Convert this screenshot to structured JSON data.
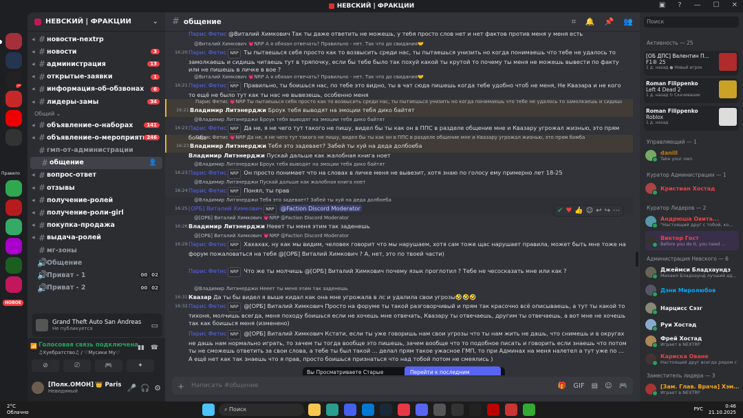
{
  "window": {
    "title": "НЕВСКИЙ | ФРАКЦИИ"
  },
  "guild": {
    "name": "НЕВСКИЙ | ФРАКЦИИ"
  },
  "channels": [
    {
      "name": "новости-nextrp",
      "badge": ""
    },
    {
      "name": "новости",
      "badge": "3"
    },
    {
      "name": "администрация",
      "badge": "13"
    },
    {
      "name": "открытые-заявки",
      "badge": "1"
    },
    {
      "name": "информация-об-обзвонах",
      "badge": "6"
    },
    {
      "name": "лидеры-замы",
      "badge": "34"
    }
  ],
  "category": "Общий",
  "channels2": [
    {
      "name": "объявление-о-наборах",
      "badge": "141"
    },
    {
      "name": "объявление-о-мероприятиях",
      "badge": "246"
    },
    {
      "name": "гмп-от-администрации",
      "badge": ""
    },
    {
      "name": "общение",
      "badge": ""
    },
    {
      "name": "вопрос-ответ",
      "badge": ""
    },
    {
      "name": "отзывы",
      "badge": ""
    },
    {
      "name": "получение-ролей",
      "badge": ""
    },
    {
      "name": "получение-роли-girl",
      "badge": ""
    },
    {
      "name": "покупка-продажа",
      "badge": ""
    },
    {
      "name": "выдача-ролей",
      "badge": ""
    },
    {
      "name": "мг-зоны",
      "badge": ""
    },
    {
      "name": "Общение",
      "badge": ""
    },
    {
      "name": "Приват - 1",
      "badge": ""
    },
    {
      "name": "Приват - 2",
      "badge": ""
    }
  ],
  "voice_counts": {
    "a": "00",
    "b": "02"
  },
  "game": {
    "name": "Grand Theft Auto San Andreas",
    "sub": "Не публикуется"
  },
  "voice": {
    "status": "Голосовая связь подключена",
    "sub": "♫Хуебратство♫ / ♡Мусики My♡"
  },
  "user": {
    "name": "[Полк.ОМОН] 👑 Paris Fet👑",
    "status": "Невидимый"
  },
  "new_label": "НОВОЕ",
  "servers_label": "Правило",
  "channel_header": {
    "name": "общение"
  },
  "messages": [
    {
      "time": "",
      "reply": "@Виталий Химкович  Так ты даже ответить не можешь, у тебя просто слов нет и нет фактов против меня у меня есть",
      "author": "Парис Фетис",
      "tag": "NRP",
      "text": ""
    },
    {
      "time": "16:20",
      "reply": "@Виталий Химкович 💗NRP  А я обязан отвечать? Правильно - нет. Так что до свидания🤝",
      "author": "Парис Фетис",
      "tag": "NRP",
      "text": "Ты пытаешься себя просто как то возвысить среди нас, ты пытаешься унизить но когда понимаешь что тебе не удалось то замолкаешь и сидишь читаешь тут в тряпочку, если бы тебе было так похуй какой ты крутой то почему ты меня не можешь вывести по факту или не пишешь в личке в вое ?"
    },
    {
      "time": "16:21",
      "reply": "@Виталий Химкович 💗NRP  А я обязан отвечать? Правильно - нет. Так что до свидания🤝",
      "author": "Парис Фетис",
      "tag": "NRP",
      "text": "Правильно, ты боишься нас, по тебе это видно, ты в чат сюда пишешь когда тебе удобно чтоб не меня, Не Квазара и не кого то ещё не было тут как ты нас не вывезешь, особенно меня"
    },
    {
      "time": "16:21",
      "reply": "Парис Фетис 💗NRP  Ты пытаешься себя просто как то возвысить среди нас, ты пытаешься унизить но когда понимаешь что тебе не удалось то замолкаешь и сидишь читае",
      "author": "Владимир Литэнерджи",
      "tag": "",
      "text": "Броук тебя выводят на эмоции тебя дико байтят"
    },
    {
      "time": "16:23",
      "reply": "@Владимир Литэнерджи Броук тебя выводят на эмоции тебя дико байтят",
      "author": "Парис Фетис",
      "tag": "NRP",
      "text": "Да не, я не чего тут такого не пишу, видел бы ты как он в ППС в разделе общение мне и Квазару угрожал жизнью, это прям бомба"
    },
    {
      "time": "16:23",
      "reply": "Парис Фетис 💗NRP  Да не, я не чего тут такого не пишу, видел бы ты как он в ППС в разделе общение мне и Квазару угрожал жизнью, это прям бомба",
      "author": "Владимир Литэнерджи",
      "tag": "",
      "text": "Тебя это задевает? Забей ты хуй на деда долбоеба"
    },
    {
      "time": "",
      "reply": "",
      "author": "Владимир Литэнерджи",
      "tag": "",
      "text": "Пускай дальше как жалобная книга ноет"
    },
    {
      "time": "16:23",
      "reply": "@Владимир Литэнерджи Броук тебя выводят на эмоции тебя дико байтят",
      "author": "Парис Фетис",
      "tag": "NRP",
      "text": "Он просто понимает что на словах в личке меня не вывезит, хотя знаю по голосу ему примерно лет 18-25"
    },
    {
      "time": "16:24",
      "reply": "@Владимир Литэнерджи Пускай дальше как жалобная книга ноет",
      "author": "Парис Фетис",
      "tag": "NRP",
      "text": "Понял, ты прав"
    },
    {
      "time": "16:25",
      "reply": "@Владимир Литэнерджи Тебя это задевает? Забей ты хуй на деда долбоеба",
      "author": "[ОРБ] Виталий Химкович",
      "tag": "NRP",
      "text": "@Faction Discord Moderator"
    },
    {
      "time": "16:26",
      "reply": "@[ОРБ] Виталий Химкович 💗NRP  @Faction Discord Moderator",
      "author": "Владимир Литэнерджи",
      "tag": "",
      "text": "Нееет ты меня этим так заденешь"
    },
    {
      "time": "16:29",
      "reply": "@[ОРБ] Виталий Химкович 💗NRP  @Faction Discord Moderator",
      "author": "Парис Фетис",
      "tag": "NRP",
      "text": "Хахахах, ну как мы видим, человек говорит что мы нарушаем, хотя сам тоже щас нарушает правила, может быть мне тоже на форум пожаловаться на тебя @[ОРБ] Виталий Химкович ? А, нет, это по твоей части)"
    },
    {
      "time": "",
      "reply": "",
      "author": "Парис Фетис",
      "tag": "NRP",
      "text": "Что же ты молчишь @[ОРБ] Виталий Химкович почему язык проглотил ? Тебе не чесосказать мне или как ?"
    },
    {
      "time": "16:31",
      "reply": "@Владимир Литэнерджи Нееет ты меня этим так заденешь",
      "author": "Квазар",
      "tag": "",
      "text": "Да ты бы видел я выше кидал как она мне угрожала в лс и удалила свои угрозы🤣🤣🤣"
    },
    {
      "time": "16:32",
      "reply": "",
      "author": "Парис Фетис",
      "tag": "NRP",
      "text": "@[ОРБ] Виталий Химкович Просто на форуме ты такой разговорчивый и прям так красочно всё описываешь, а тут ты какой то тихоня, молчишь всегда, меня походу боишься если не хочешь мне отвечать, Квазару ты отвечаешь, другим ты отвечаешь, а вот мне не хочешь так как боишься меня (изменено)"
    },
    {
      "time": "",
      "reply": "",
      "author": "Парис Фетис",
      "tag": "NRP",
      "text": "@[ОРБ] Виталий Химкович Кстати, если ты уже говоришь нам свои угрозы что ты нам жить не дашь, что снимешь и в округах не дашь нам нормально играть, то зачем ты тогда вообще это пишешь, зачем вообще что то подобное писать и говорить если знаешь что потом ты не сможешь ответить за свои слова, а тебе ты был такой ... делал прям такое ужасное ГМП, то при Админах на меня налетел а тут уже по ... А ещё нет как так знаешь что я прав, просто боишься признаться что над тобой потом не смеялись )"
    }
  ],
  "old_messages": {
    "text": "Вы Просматриваете Старые Сообщения",
    "button": "Перейти к последним сообщениям"
  },
  "composer": {
    "placeholder": "Написать #общение"
  },
  "members": {
    "search": "Поиск",
    "activity_hdr": "Активность — 25",
    "activities": [
      {
        "name": "[ОБ ДПС] Валентин П...",
        "game": "F1® 25",
        "sub": "1 д. назад  ● Новый игрок"
      },
      {
        "name": "Roman Filippenko",
        "game": "Left 4 Dead 2",
        "sub": "1 д. назад  ↻ Скачивание"
      },
      {
        "name": "Roman Filippenko",
        "game": "Roblox",
        "sub": "1 д. назад"
      }
    ],
    "groups": [
      {
        "hdr": "Управляющий — 1",
        "items": [
          {
            "name": "danill",
            "status": "Take your own",
            "color": "#c27c0e"
          }
        ]
      },
      {
        "hdr": "Куратор Администрации — 1",
        "items": [
          {
            "name": "Кристиан Хостад",
            "status": "",
            "color": "#ed4245"
          }
        ]
      },
      {
        "hdr": "Куратор Лидеров — 2",
        "items": [
          {
            "name": "Андрюша Овита...",
            "status": "\"Настоящий друг с тобой, ко...",
            "color": "#ed4245"
          },
          {
            "name": "Виктор Гост",
            "status": "Before you do it, you need ...",
            "color": "#ed4245"
          }
        ]
      },
      {
        "hdr": "Администрация Невского — 6",
        "items": [
          {
            "name": "Джеймси Бладхаундз",
            "status": "Михаил Бладхаунд лучший ад...",
            "color": "#f2f3f5"
          },
          {
            "name": "Дэни Миролюбов",
            "status": "",
            "color": "#00a8fc"
          },
          {
            "name": "Нарцисс Сэзг",
            "status": "",
            "color": "#f2f3f5"
          },
          {
            "name": "Руи Хостад",
            "status": "",
            "color": "#f2f3f5"
          },
          {
            "name": "Фрей Хостад",
            "status": "Играет в NEXTRP",
            "color": "#f2f3f5"
          },
          {
            "name": "Кариска Оване",
            "status": "Настоящий друг всегда рядом с т...",
            "color": "#ed4245"
          }
        ]
      },
      {
        "hdr": "Заместитель лидера — 3",
        "items": [
          {
            "name": "[Зам. Глав. Врача] Хэм...",
            "status": "Играет в NEXTRP",
            "color": "#faa61a"
          }
        ]
      }
    ]
  },
  "taskbar": {
    "search": "Поиск",
    "weather_temp": "2°C",
    "weather_text": "Облачно",
    "lang": "РУС",
    "time": "0:46",
    "date": "21.10.2025"
  }
}
